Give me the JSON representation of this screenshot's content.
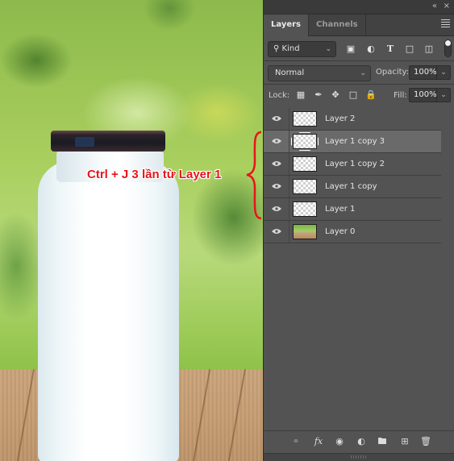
{
  "canvas": {
    "annotation": "Ctrl + J 3 lần từ Layer 1",
    "annotation_color": "#e8141b"
  },
  "panel": {
    "topbar": {
      "collapse_icon": "«",
      "close_icon": "×"
    },
    "tabs": [
      {
        "label": "Layers",
        "active": true
      },
      {
        "label": "Channels",
        "active": false
      }
    ],
    "filter": {
      "kind_label": "Kind",
      "icons": [
        "pixel-filter-icon",
        "adjustment-filter-icon",
        "type-filter-icon",
        "shape-filter-icon",
        "smart-object-filter-icon"
      ]
    },
    "blend_mode": "Normal",
    "opacity_label": "Opacity:",
    "opacity_value": "100%",
    "lock_label": "Lock:",
    "fill_label": "Fill:",
    "fill_value": "100%",
    "layers": [
      {
        "name": "Layer 2",
        "visible": true,
        "selected": false,
        "thumb": "transparent"
      },
      {
        "name": "Layer 1 copy 3",
        "visible": true,
        "selected": true,
        "thumb": "transparent"
      },
      {
        "name": "Layer 1 copy 2",
        "visible": true,
        "selected": false,
        "thumb": "transparent"
      },
      {
        "name": "Layer 1 copy",
        "visible": true,
        "selected": false,
        "thumb": "transparent"
      },
      {
        "name": "Layer 1",
        "visible": true,
        "selected": false,
        "thumb": "transparent"
      },
      {
        "name": "Layer 0",
        "visible": true,
        "selected": false,
        "thumb": "photo"
      }
    ],
    "footer_icons": [
      "link-layers-icon",
      "fx-icon",
      "add-mask-icon",
      "new-adjustment-icon",
      "new-group-icon",
      "new-layer-icon",
      "delete-layer-icon"
    ],
    "fx_label": "fx"
  }
}
